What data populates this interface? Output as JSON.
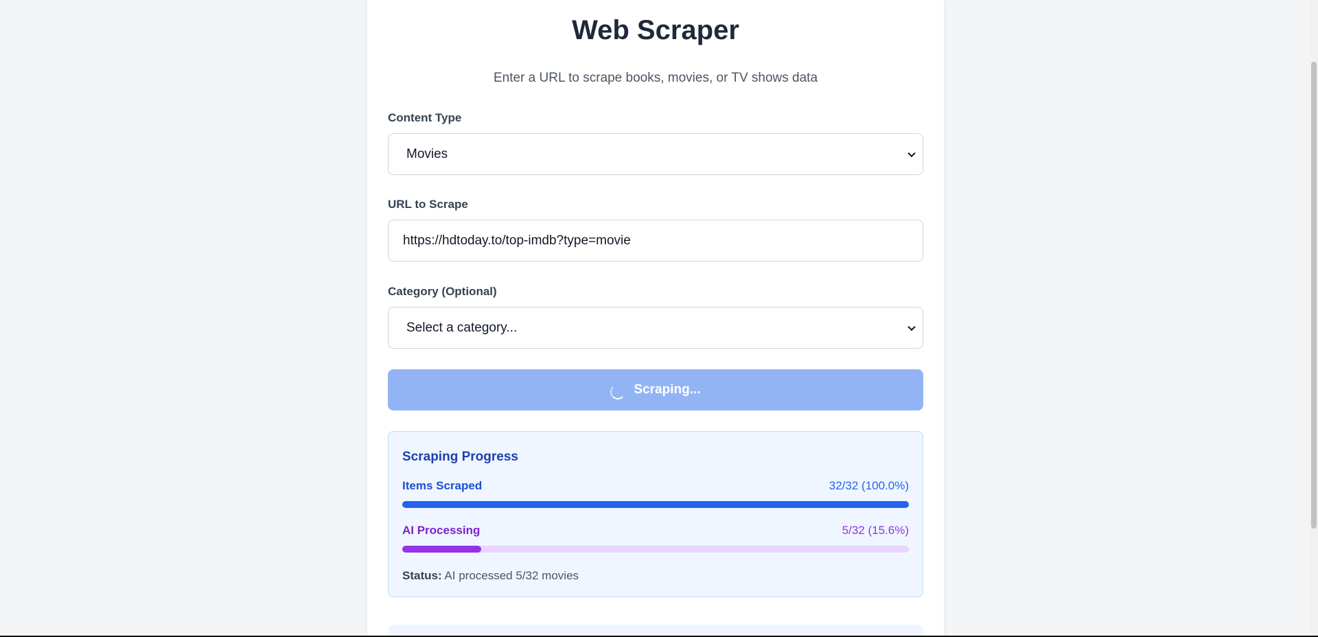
{
  "header": {
    "title": "Web Scraper",
    "subtitle": "Enter a URL to scrape books, movies, or TV shows data"
  },
  "form": {
    "content_type": {
      "label": "Content Type",
      "value": "Movies"
    },
    "url": {
      "label": "URL to Scrape",
      "value": "https://hdtoday.to/top-imdb?type=movie"
    },
    "category": {
      "label": "Category (Optional)",
      "value": "Select a category..."
    },
    "submit_label": "Scraping..."
  },
  "progress": {
    "title": "Scraping Progress",
    "items_scraped": {
      "label": "Items Scraped",
      "stat": "32/32 (100.0%)",
      "fraction": 1.0
    },
    "ai_processing": {
      "label": "AI Processing",
      "stat": "5/32 (15.6%)",
      "fraction": 0.156
    },
    "status_label": "Status:",
    "status_text": "AI processed 5/32 movies"
  },
  "colors": {
    "primary": "#2563eb",
    "purple": "#9333ea",
    "button_disabled": "#93b4f4"
  }
}
